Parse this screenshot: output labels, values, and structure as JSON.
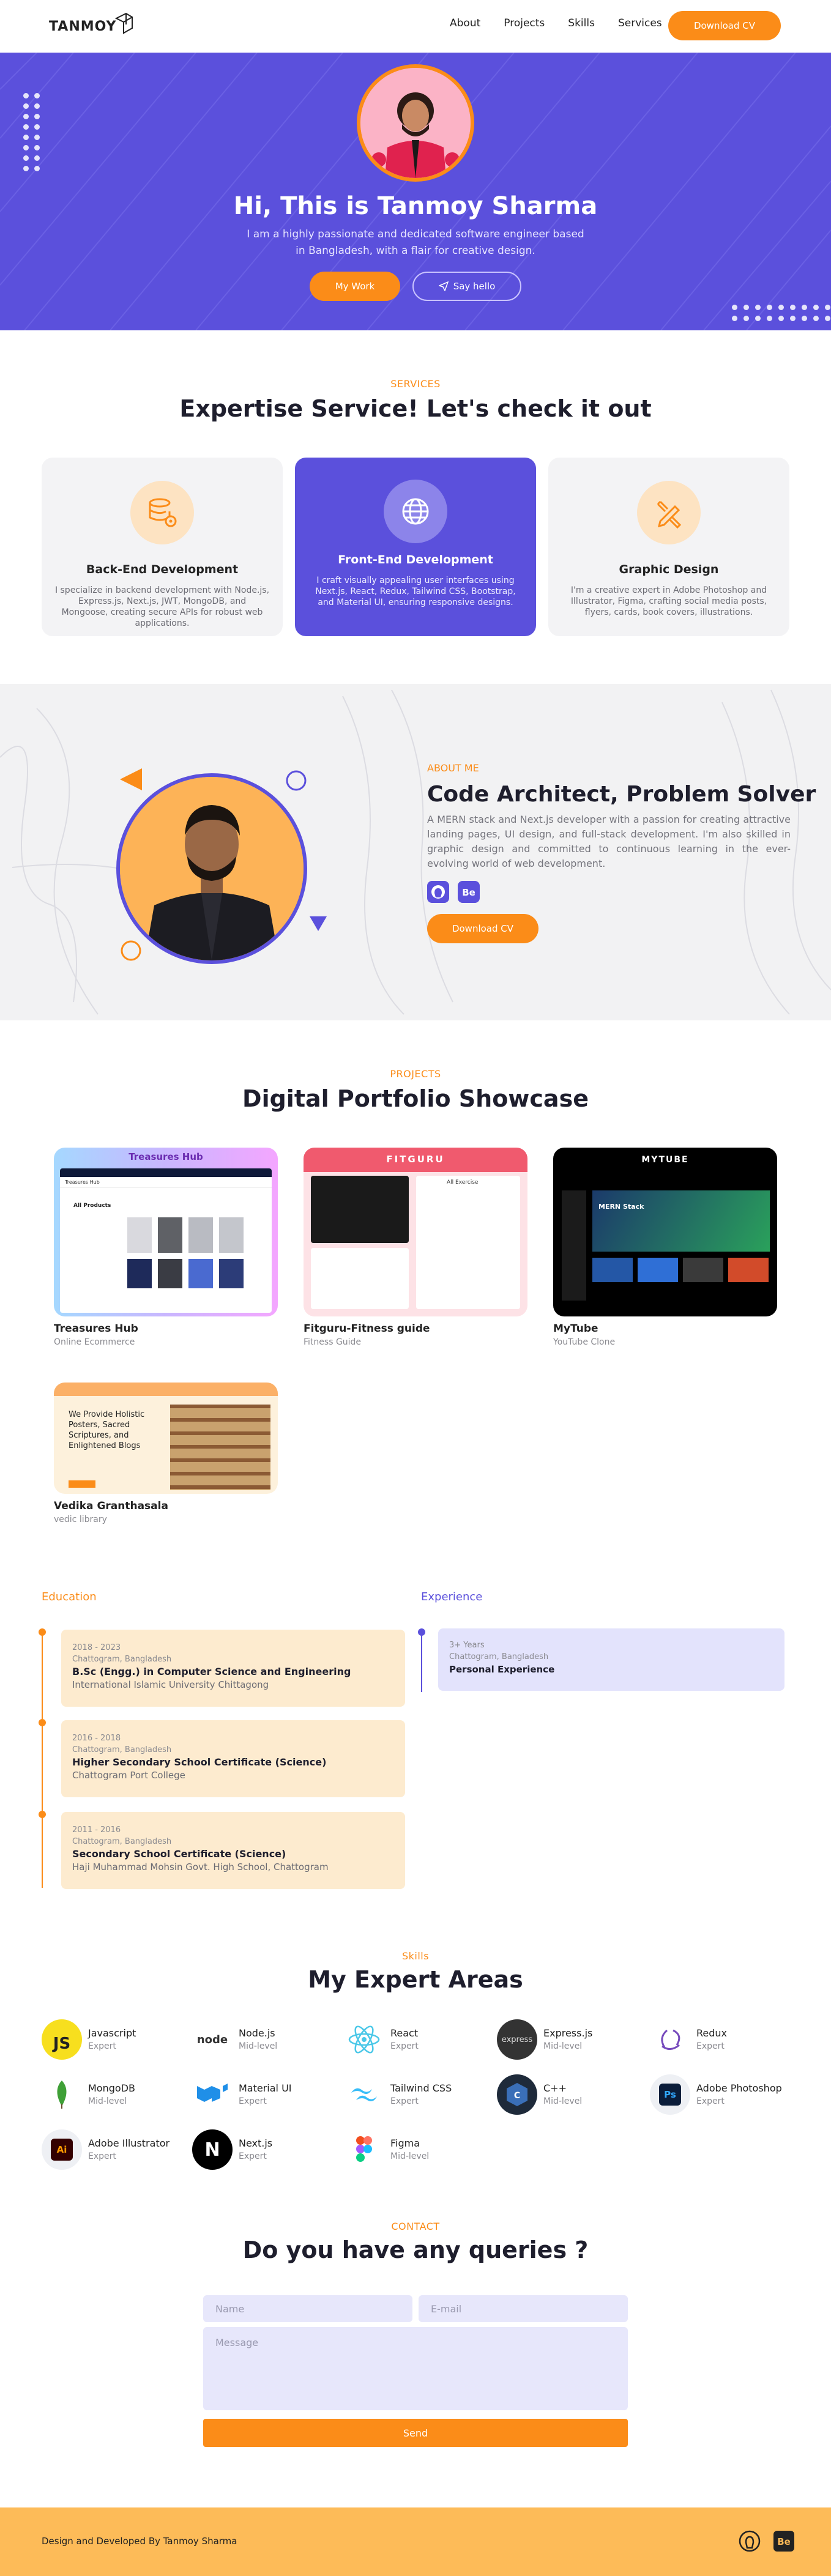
{
  "nav": {
    "brand": "TANMOY",
    "links": [
      "About",
      "Projects",
      "Skills",
      "Services"
    ],
    "cv_label": "Download CV"
  },
  "hero": {
    "title": "Hi, This is Tanmoy Sharma",
    "subtitle": "I am a highly passionate and dedicated software engineer based in Bangladesh, with a flair for creative design.",
    "work_label": "My Work",
    "hello_label": "Say hello"
  },
  "services": {
    "eyebrow": "SERVICES",
    "title": "Expertise Service! Let's check it out",
    "cards": [
      {
        "title": "Back-End Development",
        "desc": "I specialize in backend development with Node.js, Express.js, Next.js, JWT, MongoDB, and Mongoose, creating secure APIs for robust web applications.",
        "icon": "database-gear-icon"
      },
      {
        "title": "Front-End Development",
        "desc": "I craft visually appealing user interfaces using Next.js, React, Redux, Tailwind CSS, Bootstrap, and Material UI, ensuring responsive designs.",
        "icon": "globe-icon"
      },
      {
        "title": "Graphic Design",
        "desc": "I'm a creative expert in Adobe Photoshop and Illustrator, Figma, crafting social media posts, flyers, cards, book covers, illustrations.",
        "icon": "design-tools-icon"
      }
    ]
  },
  "about": {
    "eyebrow": "ABOUT ME",
    "title": "Code Architect, Problem Solver",
    "text": "A MERN stack and Next.js developer with a passion for creating attractive landing pages, UI design, and full-stack development. I'm also skilled in graphic design and committed to continuous learning in the ever-evolving world of web development.",
    "cv_label": "Download CV",
    "icons": [
      "github-icon",
      "behance-icon"
    ]
  },
  "projects": {
    "eyebrow": "PROJECTS",
    "title": "Digital Portfolio Showcase",
    "items": [
      {
        "name": "Treasures Hub",
        "sub": "Online Ecommerce",
        "banner": "Treasures Hub",
        "logo": "Treasures Hub",
        "heading": "All Products"
      },
      {
        "name": "Fitguru-Fitness guide",
        "sub": "Fitness Guide",
        "banner": "FITGURU",
        "heading": "All Exercise"
      },
      {
        "name": "MyTube",
        "sub": "YouTube Clone",
        "banner": "MYTUBE",
        "heading": "MERN Stack"
      },
      {
        "name": "Vedika Granthasala",
        "sub": "vedic library",
        "heading": "We Provide Holistic Posters, Sacred Scriptures, and Enlightened Blogs"
      }
    ]
  },
  "education": {
    "heading": "Education",
    "items": [
      {
        "years": "2018 - 2023",
        "place": "Chattogram, Bangladesh",
        "degree": "B.Sc (Engg.) in Computer Science and Engineering",
        "school": "International Islamic University Chittagong"
      },
      {
        "years": "2016 - 2018",
        "place": "Chattogram, Bangladesh",
        "degree": "Higher Secondary School Certificate (Science)",
        "school": "Chattogram Port College"
      },
      {
        "years": "2011 - 2016",
        "place": "Chattogram, Bangladesh",
        "degree": "Secondary School Certificate (Science)",
        "school": "Haji Muhammad Mohsin Govt. High School, Chattogram"
      }
    ]
  },
  "experience": {
    "heading": "Experience",
    "items": [
      {
        "years": "3+ Years",
        "place": "Chattogram, Bangladesh",
        "title": "Personal Experience"
      }
    ]
  },
  "skills": {
    "eyebrow": "Skills",
    "title": "My Expert Areas",
    "items": [
      {
        "name": "Javascript",
        "level": "Expert",
        "icon": "javascript-icon",
        "color": "#f7df1e"
      },
      {
        "name": "Node.js",
        "level": "Mid-level",
        "icon": "nodejs-icon",
        "color": "#ffffff"
      },
      {
        "name": "React",
        "level": "Expert",
        "icon": "react-icon",
        "color": "#ffffff"
      },
      {
        "name": "Express.js",
        "level": "Mid-level",
        "icon": "express-icon",
        "color": "#333333"
      },
      {
        "name": "Redux",
        "level": "Expert",
        "icon": "redux-icon",
        "color": "#ffffff"
      },
      {
        "name": "MongoDB",
        "level": "Mid-level",
        "icon": "mongodb-icon",
        "color": "#ffffff"
      },
      {
        "name": "Material UI",
        "level": "Expert",
        "icon": "material-ui-icon",
        "color": "#ffffff"
      },
      {
        "name": "Tailwind CSS",
        "level": "Expert",
        "icon": "tailwind-icon",
        "color": "#ffffff"
      },
      {
        "name": "C++",
        "level": "Mid-level",
        "icon": "cpp-icon",
        "color": "#1e2a3a"
      },
      {
        "name": "Adobe Photoshop",
        "level": "Expert",
        "icon": "photoshop-icon",
        "color": "#eef0f4"
      },
      {
        "name": "Adobe Illustrator",
        "level": "Expert",
        "icon": "illustrator-icon",
        "color": "#eef0f4"
      },
      {
        "name": "Next.js",
        "level": "Expert",
        "icon": "nextjs-icon",
        "color": "#000000"
      },
      {
        "name": "Figma",
        "level": "Mid-level",
        "icon": "figma-icon",
        "color": "#ffffff"
      }
    ]
  },
  "contact": {
    "eyebrow": "CONTACT",
    "title": "Do you have any queries ?",
    "name_placeholder": "Name",
    "email_placeholder": "E-mail",
    "message_placeholder": "Message",
    "send_label": "Send"
  },
  "footer": {
    "text": "Design and Developed By Tanmoy Sharma",
    "icons": [
      "github-icon",
      "behance-icon"
    ]
  },
  "colors": {
    "primary": "#5b50dc",
    "accent": "#fb8c18",
    "footer": "#fdbb58"
  }
}
